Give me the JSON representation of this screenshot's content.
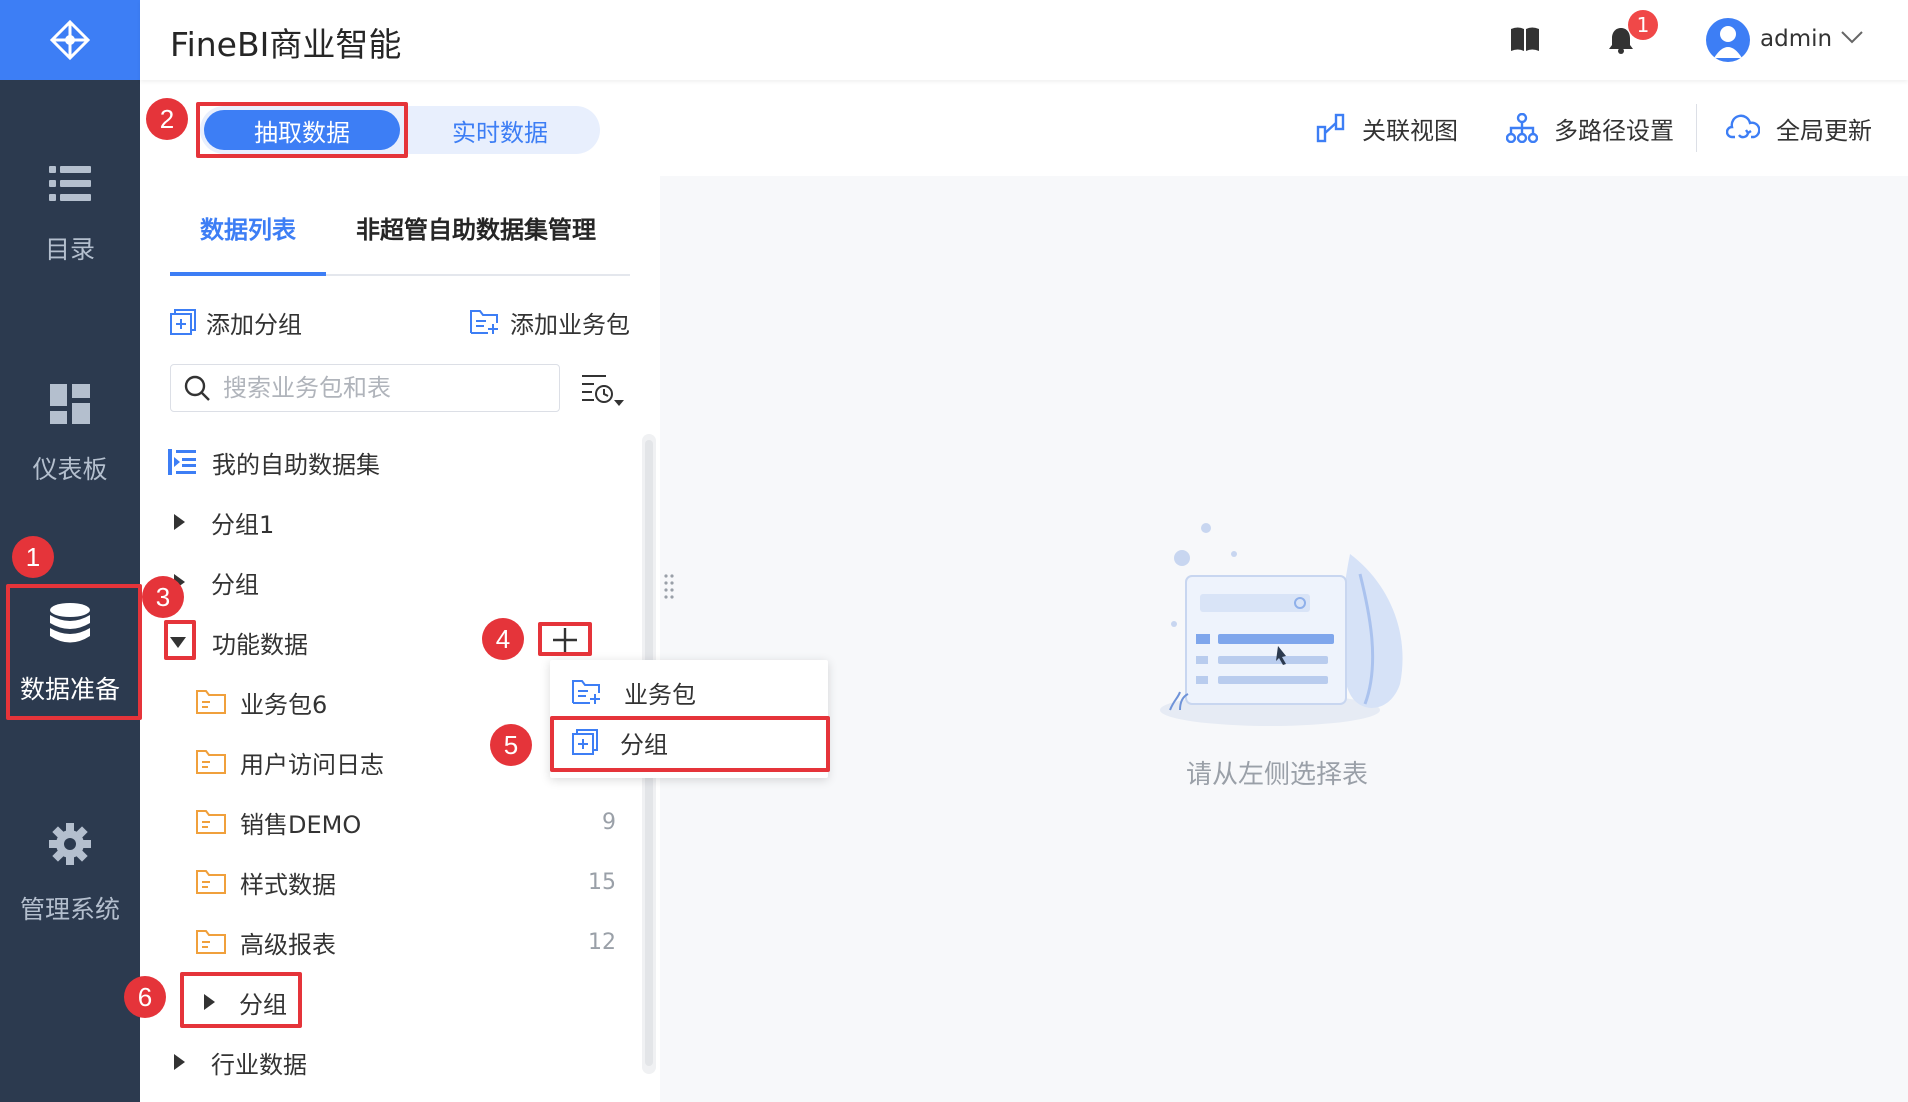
{
  "app": {
    "title": "FineBI商业智能"
  },
  "nav": {
    "items": [
      {
        "label": "目录",
        "icon": "list-icon"
      },
      {
        "label": "仪表板",
        "icon": "dashboard-icon"
      },
      {
        "label": "数据准备",
        "icon": "database-icon",
        "active": true
      },
      {
        "label": "管理系统",
        "icon": "gear-icon"
      }
    ]
  },
  "header": {
    "notification_count": "1",
    "user": "admin"
  },
  "toolbar": {
    "extract_label": "抽取数据",
    "realtime_label": "实时数据",
    "relation_view": "关联视图",
    "multipath": "多路径设置",
    "global_update": "全局更新"
  },
  "panel": {
    "tabs": [
      {
        "label": "数据列表"
      },
      {
        "label": "非超管自助数据集管理"
      }
    ],
    "add_group": "添加分组",
    "add_package": "添加业务包",
    "search_placeholder": "搜索业务包和表",
    "tree": [
      {
        "label": "我的自助数据集"
      },
      {
        "label": "分组1"
      },
      {
        "label": "分组"
      },
      {
        "label": "功能数据"
      },
      {
        "label": "业务包6"
      },
      {
        "label": "用户访问日志"
      },
      {
        "label": "销售DEMO",
        "count": "9"
      },
      {
        "label": "样式数据",
        "count": "15"
      },
      {
        "label": "高级报表",
        "count": "12"
      },
      {
        "label": "分组"
      },
      {
        "label": "行业数据"
      }
    ]
  },
  "popup": {
    "items": [
      {
        "label": "业务包"
      },
      {
        "label": "分组"
      }
    ]
  },
  "empty": {
    "text": "请从左侧选择表"
  },
  "annotations": {
    "labels": [
      "1",
      "2",
      "3",
      "4",
      "5",
      "6"
    ]
  },
  "colors": {
    "accent": "#3d7ef5",
    "nav_bg": "#2c3a4f",
    "highlight": "#e5343a",
    "folder": "#f0a03c"
  }
}
